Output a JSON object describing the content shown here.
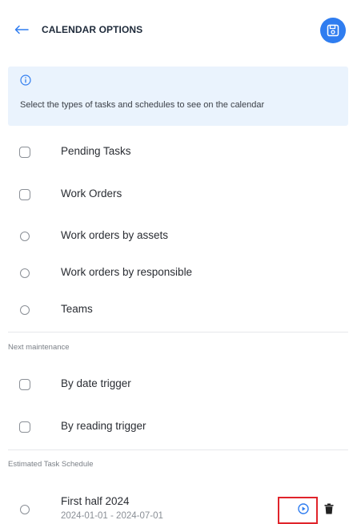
{
  "header": {
    "title": "CALENDAR OPTIONS"
  },
  "info": {
    "text": "Select the types of tasks and schedules to see on the calendar"
  },
  "options": [
    {
      "label": "Pending Tasks"
    },
    {
      "label": "Work Orders"
    },
    {
      "label": "Work orders by assets"
    },
    {
      "label": "Work orders by responsible"
    },
    {
      "label": "Teams"
    }
  ],
  "next_maintenance": {
    "heading": "Next maintenance",
    "items": [
      {
        "label": "By date trigger"
      },
      {
        "label": "By reading trigger"
      }
    ]
  },
  "estimated_schedule": {
    "heading": "Estimated Task Schedule",
    "items": [
      {
        "name": "First half 2024",
        "dates": "2024-01-01 - 2024-07-01"
      }
    ]
  },
  "colors": {
    "accent": "#2f7df0",
    "info_bg": "#eaf3fd",
    "highlight": "#e0242b"
  },
  "icons": {
    "back": "arrow-left-icon",
    "save": "save-icon",
    "info": "info-icon",
    "play": "play-circle-icon",
    "delete": "trash-icon"
  }
}
